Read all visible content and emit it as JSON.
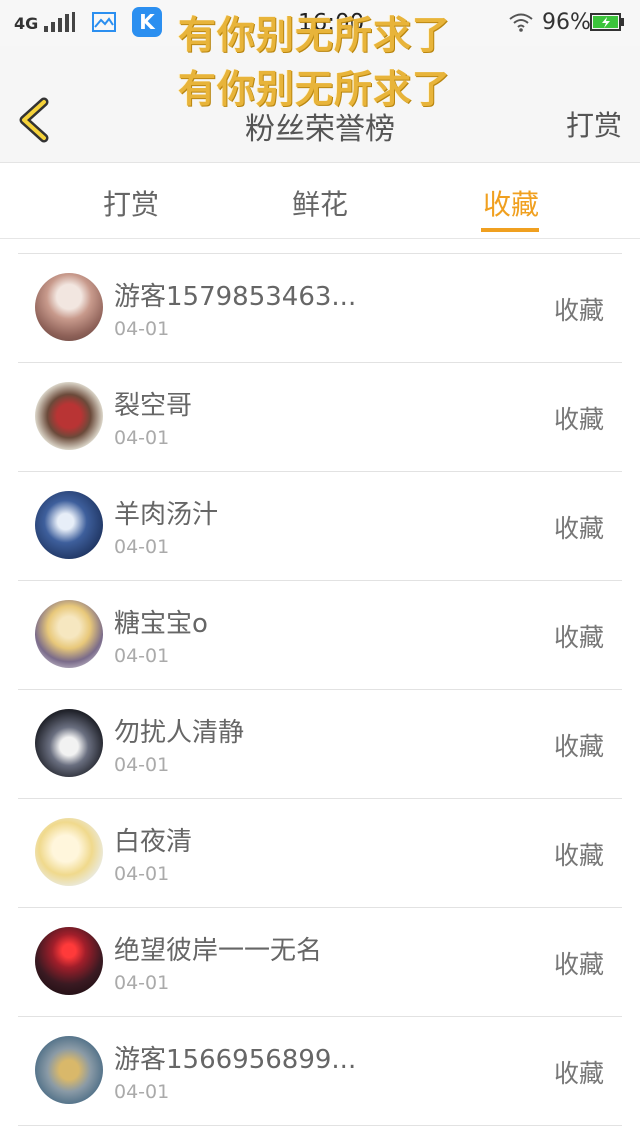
{
  "status_bar": {
    "network": "4G",
    "time": "16:00",
    "battery": "96%"
  },
  "overlay_caption": [
    "有你别无所求了",
    "有你别无所求了"
  ],
  "header": {
    "title": "粉丝荣誉榜",
    "action": "打赏"
  },
  "tabs": [
    "打赏",
    "鲜花",
    "收藏"
  ],
  "active_tab": 2,
  "colors": {
    "accent": "#f0a020",
    "caption": "#e8b43a"
  },
  "rows": [
    {
      "name": "游客1579853463...",
      "date": "04-01",
      "action": "收藏"
    },
    {
      "name": "裂空哥",
      "date": "04-01",
      "action": "收藏"
    },
    {
      "name": "羊肉汤汁",
      "date": "04-01",
      "action": "收藏"
    },
    {
      "name": "糖宝宝o",
      "date": "04-01",
      "action": "收藏"
    },
    {
      "name": "勿扰人清静",
      "date": "04-01",
      "action": "收藏"
    },
    {
      "name": "白夜清",
      "date": "04-01",
      "action": "收藏"
    },
    {
      "name": "绝望彼岸一一无名",
      "date": "04-01",
      "action": "收藏"
    },
    {
      "name": "游客1566956899...",
      "date": "04-01",
      "action": "收藏"
    }
  ]
}
